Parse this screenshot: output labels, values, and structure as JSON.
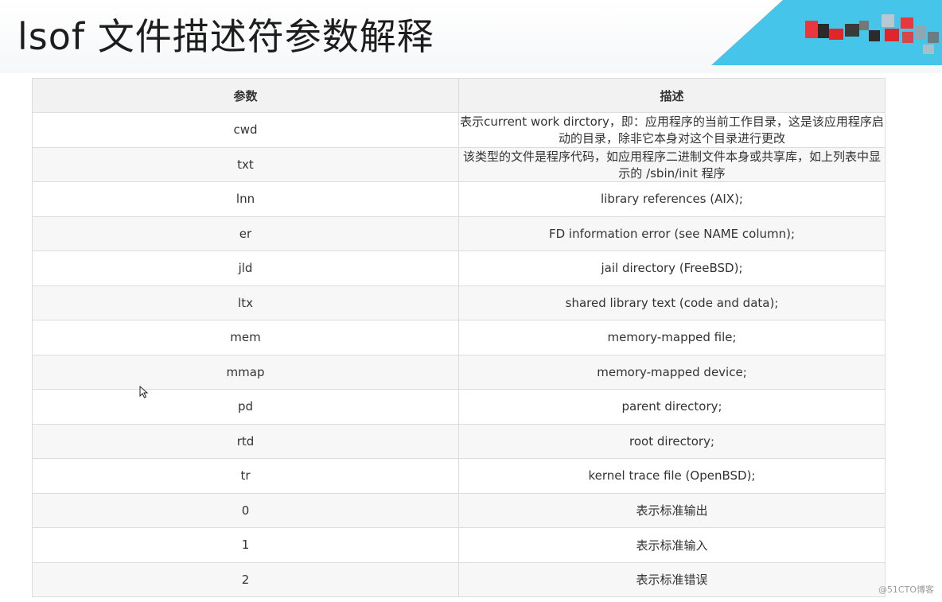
{
  "slide": {
    "title": "lsof 文件描述符参数解释"
  },
  "table": {
    "headers": {
      "param": "参数",
      "desc": "描述"
    },
    "rows": [
      {
        "param": "cwd",
        "desc": "表示current work dirctory，即：应用程序的当前工作目录，这是该应用程序启动的目录，除非它本身对这个目录进行更改"
      },
      {
        "param": "txt",
        "desc": "该类型的文件是程序代码，如应用程序二进制文件本身或共享库，如上列表中显示的 /sbin/init 程序"
      },
      {
        "param": "lnn",
        "desc": "library references (AIX);"
      },
      {
        "param": "er",
        "desc": "FD information error (see NAME column);"
      },
      {
        "param": "jld",
        "desc": "jail directory (FreeBSD);"
      },
      {
        "param": "ltx",
        "desc": "shared library text (code and data);"
      },
      {
        "param": "mem",
        "desc": "memory-mapped file;"
      },
      {
        "param": "mmap",
        "desc": "memory-mapped device;"
      },
      {
        "param": "pd",
        "desc": "parent directory;"
      },
      {
        "param": "rtd",
        "desc": "root directory;"
      },
      {
        "param": "tr",
        "desc": "kernel trace file (OpenBSD);"
      },
      {
        "param": "0",
        "desc": "表示标准输出"
      },
      {
        "param": "1",
        "desc": "表示标准输入"
      },
      {
        "param": "2",
        "desc": "表示标准错误"
      }
    ]
  },
  "watermark": "@51CTO博客",
  "colors": {
    "accent": "#46c5ea",
    "logo_red": "#e0262b",
    "header_bg": "#f2f2f2",
    "border": "#dcdcdc"
  },
  "icons": {
    "cursor": "mouse-pointer-icon",
    "logo": "pixelated-logo"
  }
}
